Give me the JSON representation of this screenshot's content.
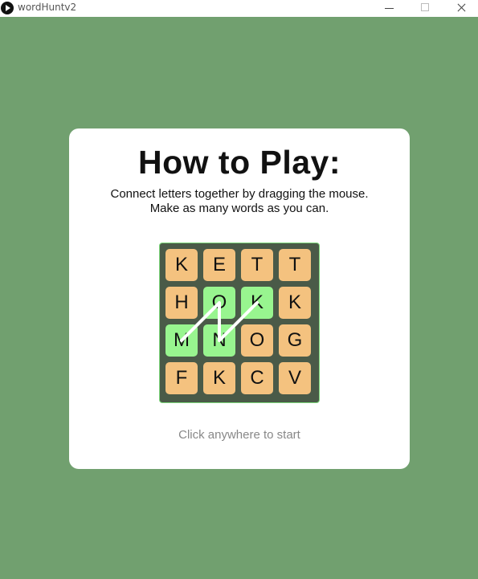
{
  "window": {
    "title": "wordHuntv2"
  },
  "instructions": {
    "heading": "How to Play:",
    "line1": "Connect letters together by dragging the mouse.",
    "line2": "Make as many words as you can.",
    "start_prompt": "Click anywhere to start"
  },
  "board": {
    "rows": [
      [
        "K",
        "E",
        "T",
        "T"
      ],
      [
        "H",
        "O",
        "K",
        "K"
      ],
      [
        "M",
        "N",
        "O",
        "G"
      ],
      [
        "F",
        "K",
        "C",
        "V"
      ]
    ],
    "selected_path": [
      [
        2,
        0
      ],
      [
        1,
        1
      ],
      [
        2,
        1
      ],
      [
        1,
        2
      ]
    ]
  },
  "colors": {
    "background": "#71a06f",
    "tile": "#f4c27f",
    "tile_selected": "#98f58f",
    "board": "#4a5a48"
  }
}
